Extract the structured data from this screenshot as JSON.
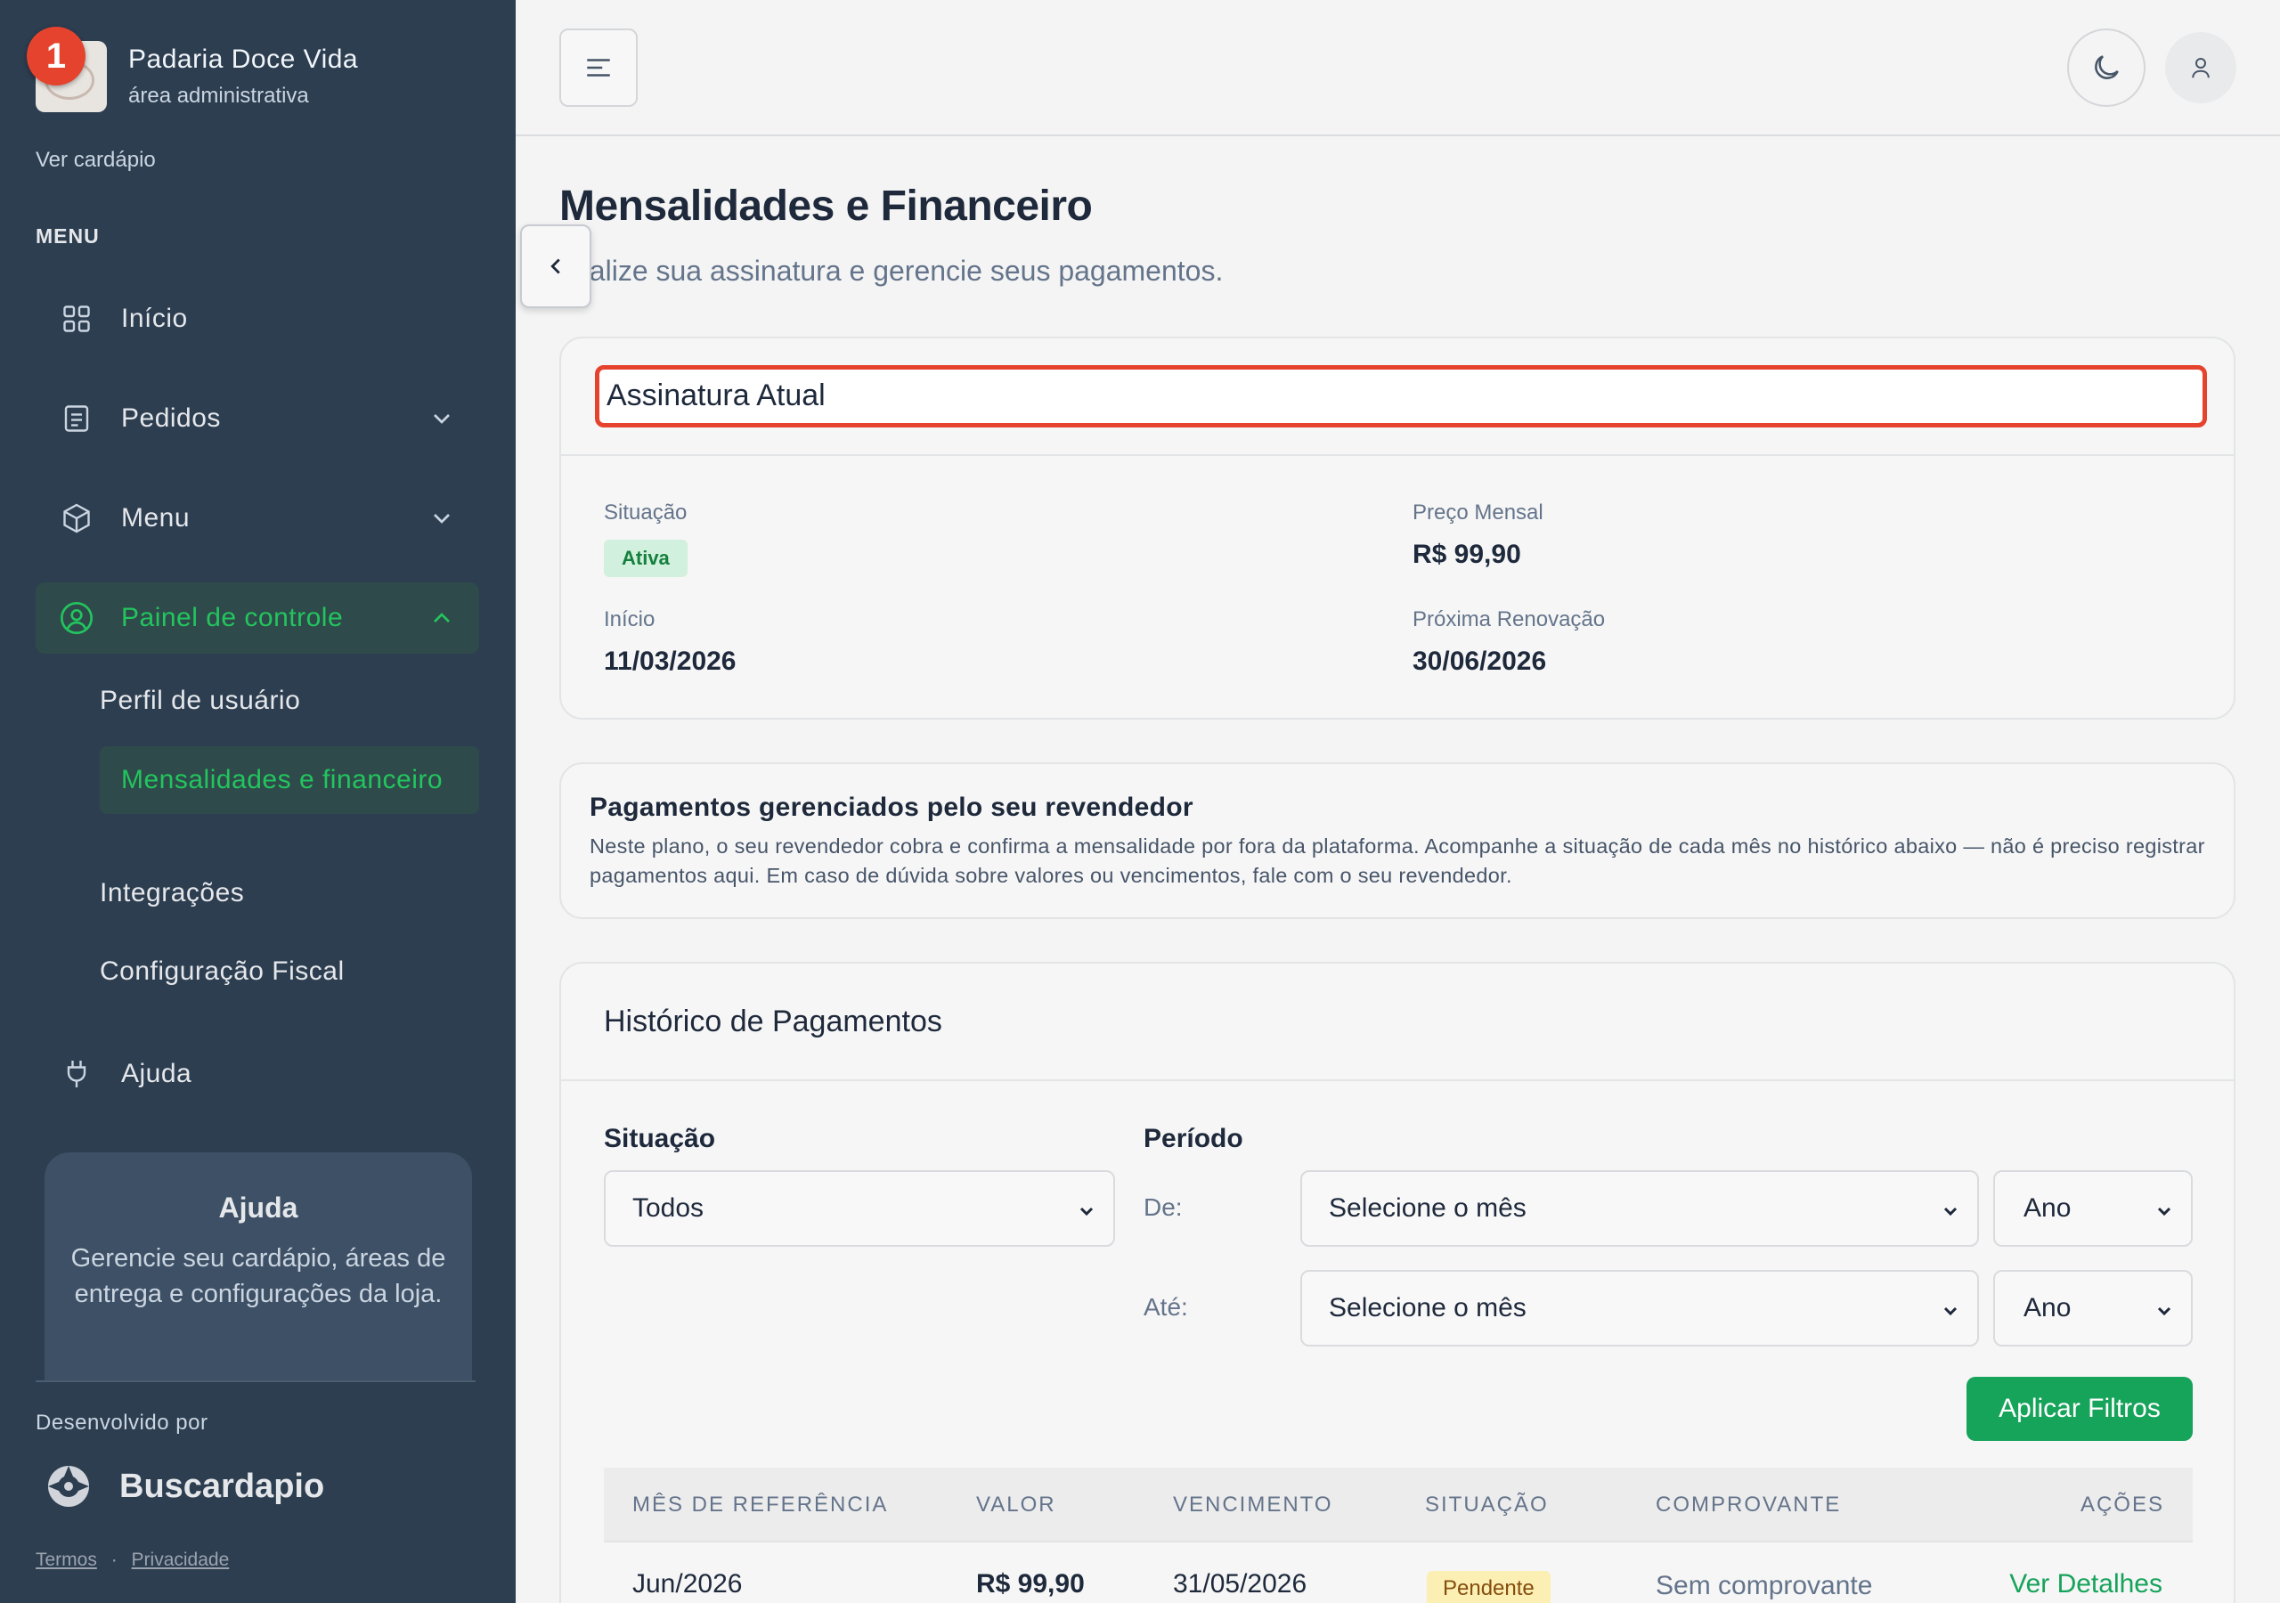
{
  "brand": {
    "name": "Padaria Doce Vida",
    "subtitle": "área administrativa",
    "badge": "1"
  },
  "sidebar": {
    "ver_cardapio": "Ver cardápio",
    "menu_heading": "MENU",
    "items": [
      {
        "label": "Início"
      },
      {
        "label": "Pedidos"
      },
      {
        "label": "Menu"
      },
      {
        "label": "Painel de controle"
      },
      {
        "label": "Ajuda"
      }
    ],
    "sub_items": [
      {
        "label": "Perfil de usuário"
      },
      {
        "label": "Mensalidades e financeiro"
      },
      {
        "label": "Integrações"
      },
      {
        "label": "Configuração Fiscal"
      }
    ],
    "help_card": {
      "title": "Ajuda",
      "description": "Gerencie seu cardápio, áreas de entrega e configurações da loja."
    },
    "developed_by": "Desenvolvido por",
    "dev_brand": "Buscardapio",
    "footer": {
      "terms": "Termos",
      "separator": "·",
      "privacy": "Privacidade"
    }
  },
  "page": {
    "title": "Mensalidades e Financeiro",
    "subtitle": "sualize sua assinatura e gerencie seus pagamentos."
  },
  "subscription": {
    "title": "Assinatura Atual",
    "status_label": "Situação",
    "status_value": "Ativa",
    "price_label": "Preço Mensal",
    "price_value": "R$ 99,90",
    "start_label": "Início",
    "start_value": "11/03/2026",
    "renewal_label": "Próxima Renovação",
    "renewal_value": "30/06/2026"
  },
  "info": {
    "title": "Pagamentos gerenciados pelo seu revendedor",
    "description": "Neste plano, o seu revendedor cobra e confirma a mensalidade por fora da plataforma. Acompanhe a situação de cada mês no histórico abaixo — não é preciso registrar pagamentos aqui. Em caso de dúvida sobre valores ou vencimentos, fale com o seu revendedor."
  },
  "history": {
    "title": "Histórico de Pagamentos",
    "status_filter_label": "Situação",
    "status_filter_value": "Todos",
    "period_label": "Período",
    "from_label": "De:",
    "to_label": "Até:",
    "month_placeholder": "Selecione o mês",
    "year_placeholder": "Ano",
    "apply_button": "Aplicar Filtros",
    "columns": [
      "MÊS DE REFERÊNCIA",
      "VALOR",
      "VENCIMENTO",
      "SITUAÇÃO",
      "COMPROVANTE",
      "AÇÕES"
    ],
    "rows": [
      {
        "month": "Jun/2026",
        "value": "R$ 99,90",
        "due": "31/05/2026",
        "status": "Pendente",
        "receipt": "Sem comprovante",
        "action": "Ver Detalhes"
      }
    ]
  },
  "colors": {
    "accent": "#16a35a",
    "highlight": "#e5432e",
    "sidebar": "#2c3e50"
  }
}
